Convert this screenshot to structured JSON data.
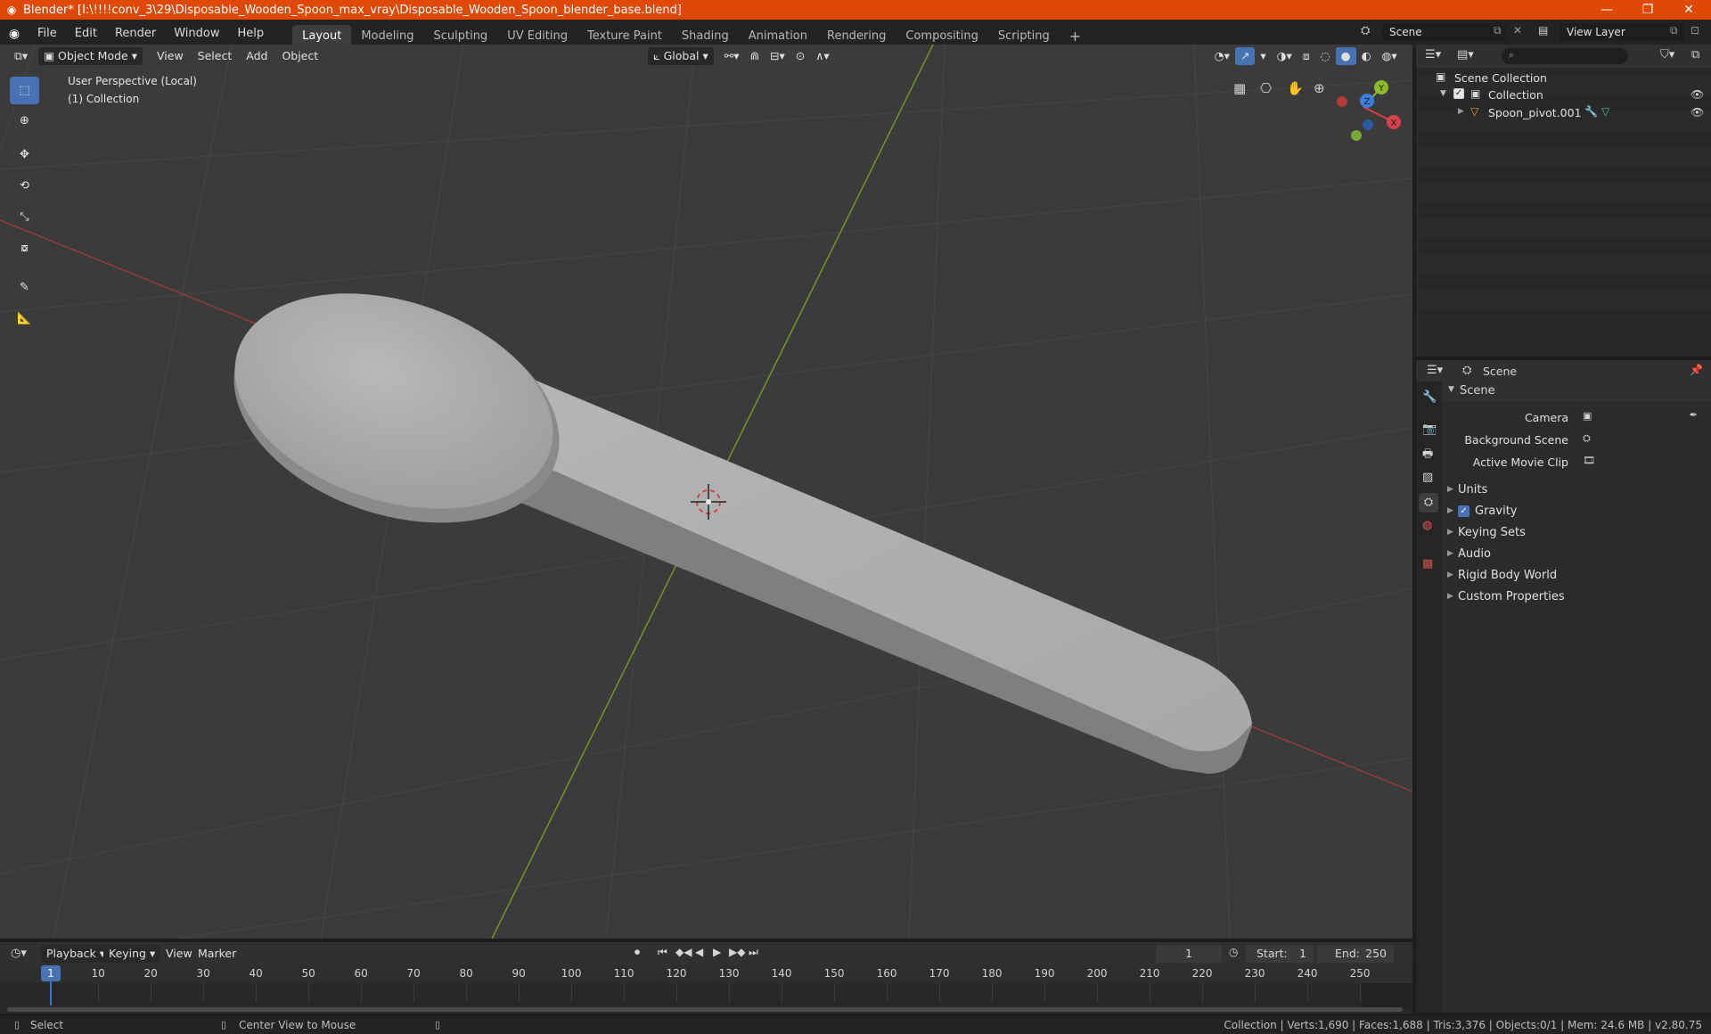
{
  "window": {
    "title": "Blender* [I:\\!!!!conv_3\\29\\Disposable_Wooden_Spoon_max_vray\\Disposable_Wooden_Spoon_blender_base.blend]"
  },
  "menus": [
    "File",
    "Edit",
    "Render",
    "Window",
    "Help"
  ],
  "workspaces": [
    "Layout",
    "Modeling",
    "Sculpting",
    "UV Editing",
    "Texture Paint",
    "Shading",
    "Animation",
    "Rendering",
    "Compositing",
    "Scripting"
  ],
  "active_workspace": "Layout",
  "scene_field": "Scene",
  "view_layer_field": "View Layer",
  "viewport_header": {
    "mode": "Object Mode",
    "menus": [
      "View",
      "Select",
      "Add",
      "Object"
    ],
    "orientation": "Global"
  },
  "viewport": {
    "perspective_label": "User Perspective (Local)",
    "collection_label": "(1) Collection"
  },
  "gizmo": {
    "x": "X",
    "y": "Y",
    "z": "Z"
  },
  "outliner": {
    "scene_collection": "Scene Collection",
    "collection": "Collection",
    "object": "Spoon_pivot.001"
  },
  "properties": {
    "header_title": "Scene",
    "section": "Scene",
    "camera_label": "Camera",
    "background_label": "Background Scene",
    "movieclip_label": "Active Movie Clip",
    "panels": [
      "Units",
      "Gravity",
      "Keying Sets",
      "Audio",
      "Rigid Body World",
      "Custom Properties"
    ],
    "gravity_enabled": true
  },
  "timeline": {
    "menus": [
      "Playback",
      "Keying",
      "View",
      "Marker"
    ],
    "current_frame": "1",
    "start_label": "Start:",
    "start": "1",
    "end_label": "End:",
    "end": "250",
    "ticks": [
      "10",
      "20",
      "30",
      "40",
      "50",
      "60",
      "70",
      "80",
      "90",
      "100",
      "110",
      "120",
      "130",
      "140",
      "150",
      "160",
      "170",
      "180",
      "190",
      "200",
      "210",
      "220",
      "230",
      "240",
      "250"
    ]
  },
  "statusbar": {
    "left_action": "Select",
    "middle_action": "Center View to Mouse",
    "stats": "Collection | Verts:1,690 | Faces:1,688 | Tris:3,376 | Objects:0/1 | Mem: 24.6 MB | v2.80.75"
  },
  "colors": {
    "title_bar": "#e04808",
    "accent": "#4772b3",
    "x_axis": "#d9404c",
    "y_axis": "#8cbc2c",
    "z_axis": "#3a7ee0"
  }
}
